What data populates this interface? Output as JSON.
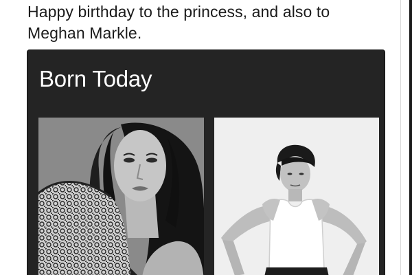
{
  "post": {
    "text": "Happy birthday to the princess, and also to Meghan Markle."
  },
  "card": {
    "title": "Born Today"
  }
}
